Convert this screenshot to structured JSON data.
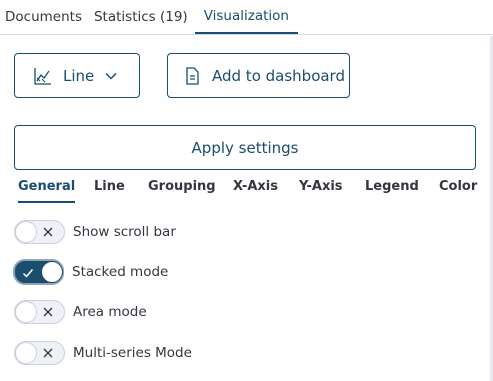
{
  "tabs": [
    {
      "label": "Documents",
      "active": false
    },
    {
      "label": "Statistics (19)",
      "active": false
    },
    {
      "label": "Visualization",
      "active": true
    }
  ],
  "chart_type_button": {
    "label": "Line",
    "icon": "line-chart-icon"
  },
  "add_dashboard_button": {
    "label": "Add to dashboard",
    "icon": "dashboard-doc-icon"
  },
  "apply_button": {
    "label": "Apply settings"
  },
  "settings_tabs": [
    {
      "label": "General",
      "active": true
    },
    {
      "label": "Line",
      "active": false
    },
    {
      "label": "Grouping",
      "active": false
    },
    {
      "label": "X-Axis",
      "active": false
    },
    {
      "label": "Y-Axis",
      "active": false
    },
    {
      "label": "Legend",
      "active": false
    },
    {
      "label": "Color",
      "active": false
    }
  ],
  "options": [
    {
      "label": "Show scroll bar",
      "checked": false
    },
    {
      "label": "Stacked mode",
      "checked": true
    },
    {
      "label": "Area mode",
      "checked": false
    },
    {
      "label": "Multi-series Mode",
      "checked": false
    }
  ],
  "colors": {
    "accent": "#1a4d6e",
    "text": "#343741",
    "border": "#d3dae6"
  }
}
